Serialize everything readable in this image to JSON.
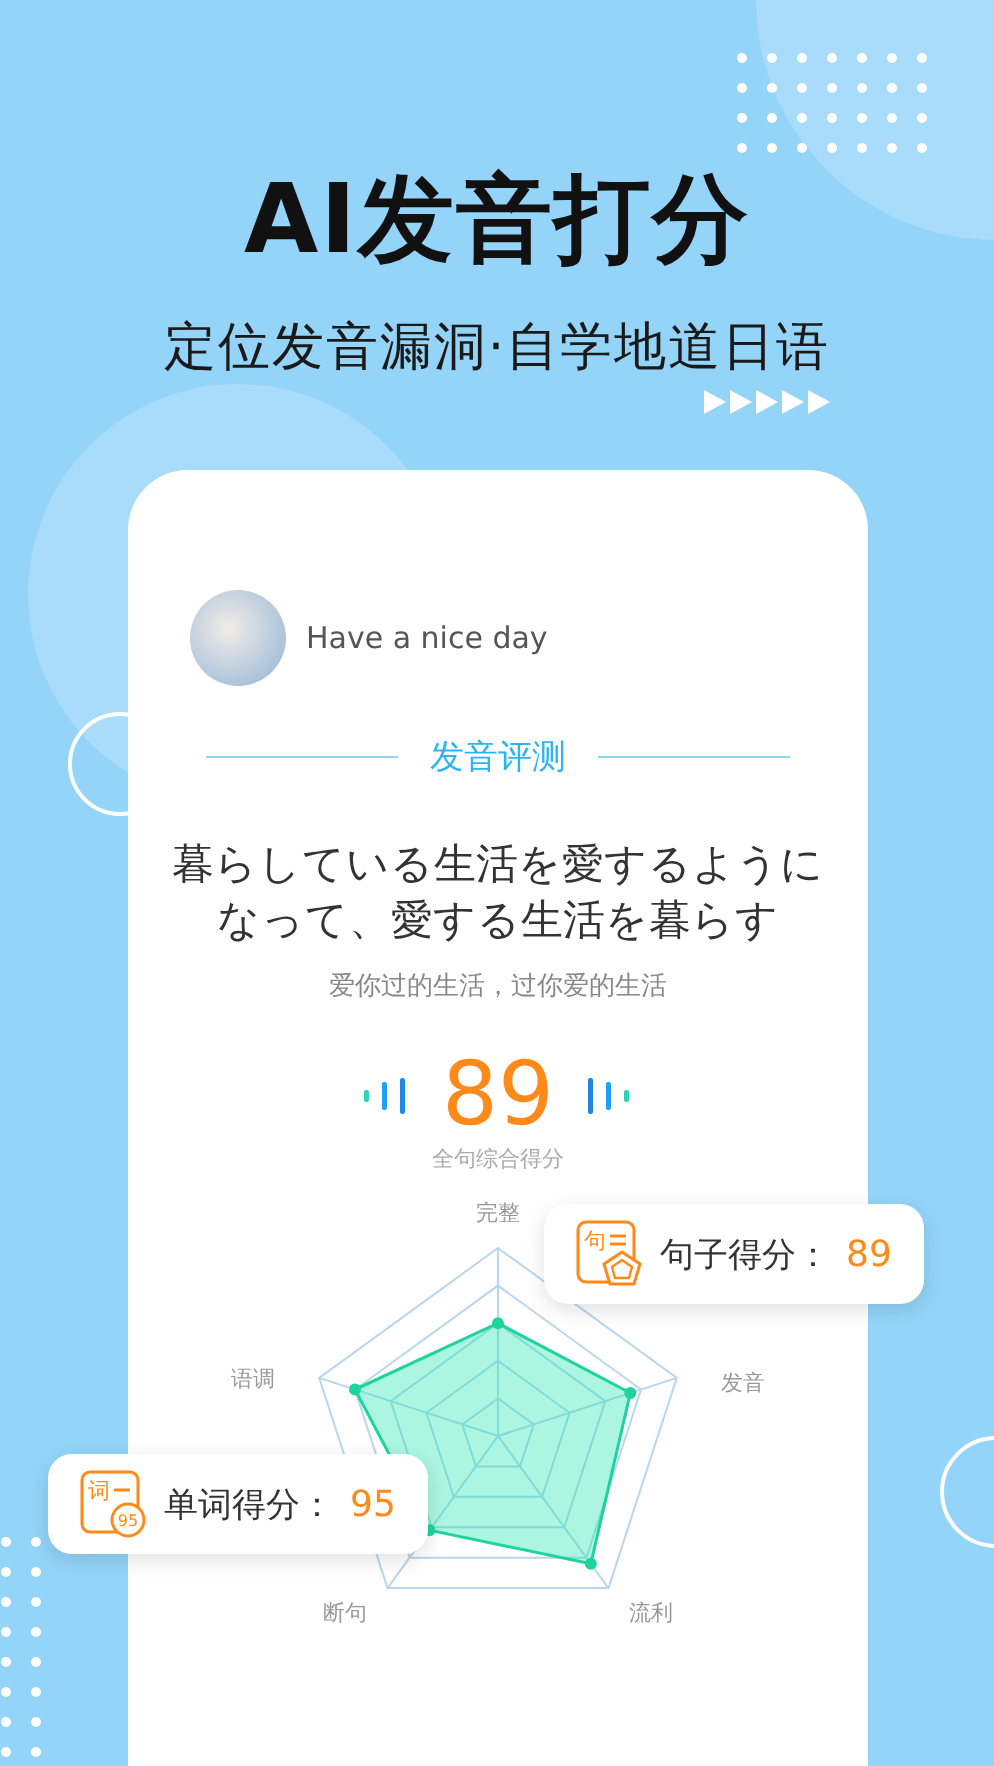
{
  "headline": "AI发音打分",
  "subtitle": "定位发音漏洞·自学地道日语",
  "card": {
    "user": {
      "name": "Have a nice day"
    },
    "section_title": "发音评测",
    "sentence": [
      "暮らしている生活を愛するように",
      "なって、愛する生活を暮らす"
    ],
    "translation": "爱你过的生活，过你爱的生活",
    "score": "89",
    "score_label": "全句综合得分",
    "radar_labels": [
      "完整",
      "发音",
      "流利",
      "断句",
      "语调"
    ]
  },
  "popups": [
    {
      "kind": "sentence",
      "icon_text": "句",
      "label": "句子得分：",
      "value": "89"
    },
    {
      "kind": "word",
      "icon_text": "词",
      "badge": "95",
      "label": "单词得分：",
      "value": "95"
    }
  ]
}
